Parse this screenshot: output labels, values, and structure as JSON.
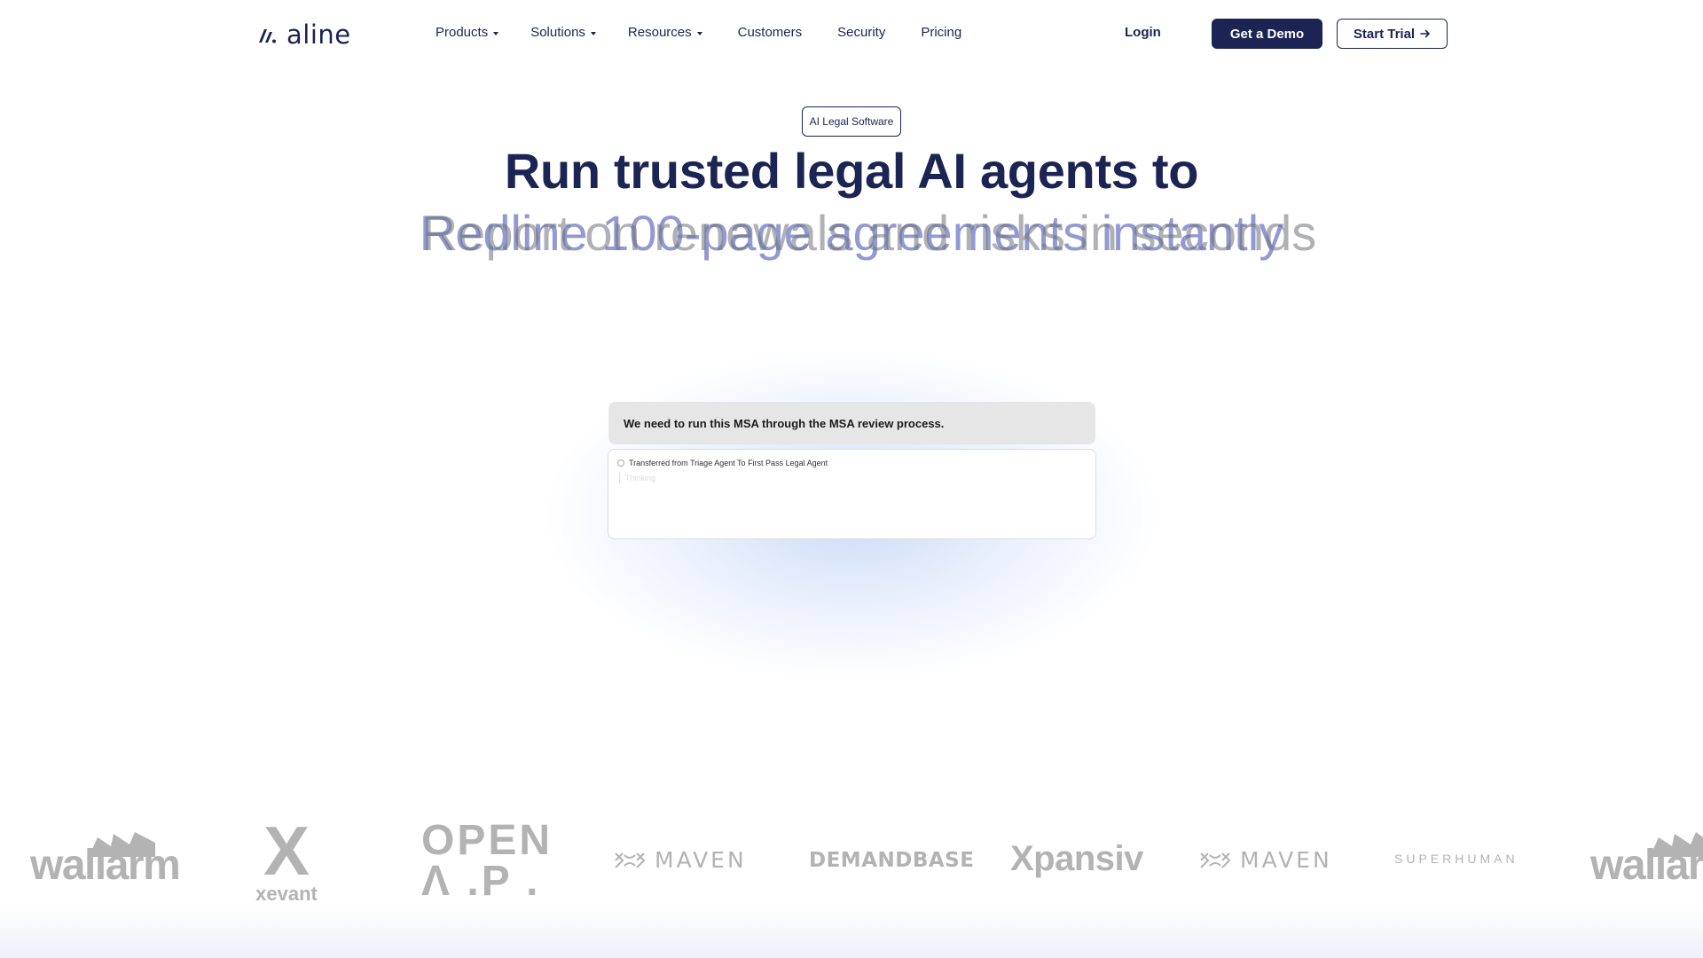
{
  "brand": {
    "name": "aline"
  },
  "nav": {
    "items": [
      {
        "label": "Products",
        "dropdown": true
      },
      {
        "label": "Solutions",
        "dropdown": true
      },
      {
        "label": "Resources",
        "dropdown": true
      },
      {
        "label": "Customers",
        "dropdown": false
      },
      {
        "label": "Security",
        "dropdown": false
      },
      {
        "label": "Pricing",
        "dropdown": false
      }
    ],
    "login": "Login",
    "demo": "Get a Demo",
    "trial": "Start Trial",
    "trial_icon": "arrow-right-icon"
  },
  "hero": {
    "tag": "AI Legal Software",
    "headline": "Run trusted legal AI agents to",
    "rotating_a": "Redline 100-page agreements instantly",
    "rotating_b": "Report on renewals and risks in seconds"
  },
  "demo": {
    "prompt": "We need to run this MSA through the MSA review process.",
    "transfer": "Transferred from Triage Agent To First Pass Legal Agent",
    "status": "Thinking"
  },
  "logos": {
    "items": [
      "wallarm",
      "xevant",
      "OPEN",
      "Λ .P .",
      "MAVEN",
      "DEMANDBASE",
      "Xpansiv",
      "MAVEN",
      "SUPERHUMAN",
      "wallarm"
    ]
  },
  "colors": {
    "primary": "#1b2452",
    "accent_rotating": "#8088cc",
    "logo_gray": "#b3b3b3"
  }
}
